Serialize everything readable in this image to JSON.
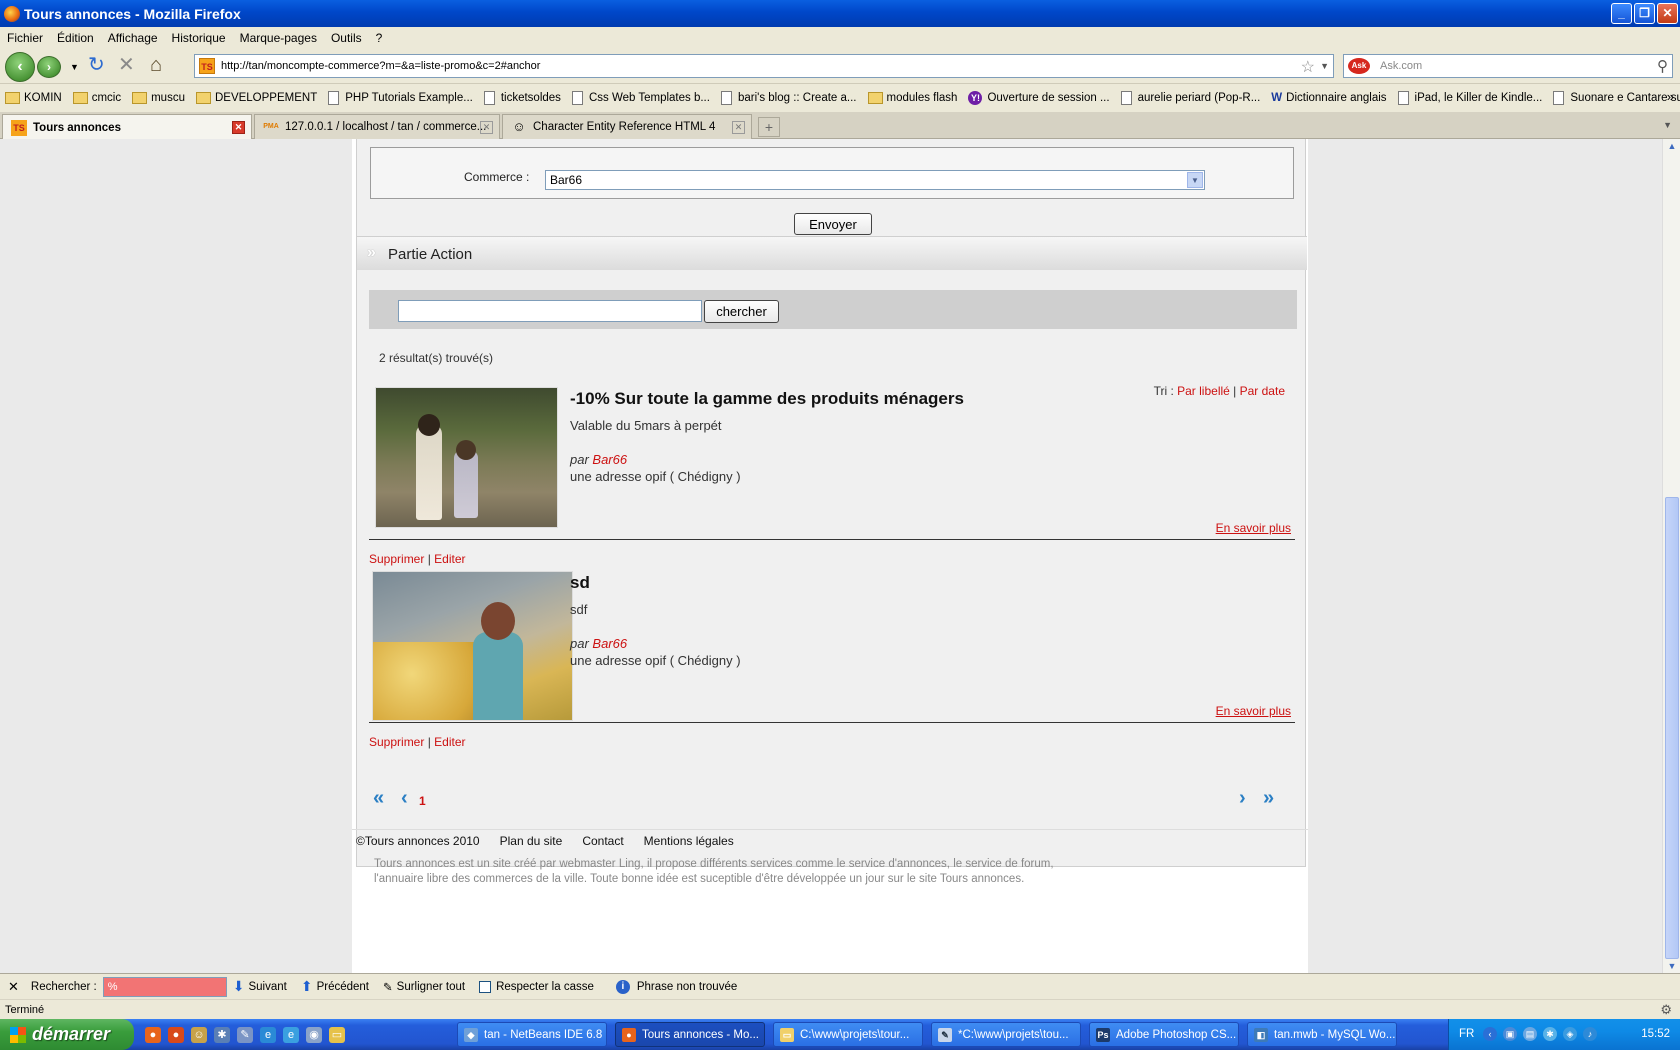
{
  "window": {
    "title": "Tours annonces - Mozilla Firefox",
    "min": "_",
    "max": "❐",
    "close": "✕"
  },
  "menu": [
    "Fichier",
    "Édition",
    "Affichage",
    "Historique",
    "Marque-pages",
    "Outils",
    "?"
  ],
  "nav": {
    "url": "http://tan/moncompte-commerce?m=&a=liste-promo&c=2#anchor",
    "site_icon": "TS",
    "search_placeholder": "Ask.com",
    "search_engine": "Ask"
  },
  "bookmarks": [
    {
      "label": "KOMIN",
      "icon": "folder"
    },
    {
      "label": "cmcic",
      "icon": "folder"
    },
    {
      "label": "muscu",
      "icon": "folder"
    },
    {
      "label": "DEVELOPPEMENT",
      "icon": "folder"
    },
    {
      "label": "PHP Tutorials Example...",
      "icon": "page"
    },
    {
      "label": "ticketsoldes",
      "icon": "page"
    },
    {
      "label": "Css Web Templates b...",
      "icon": "page"
    },
    {
      "label": "bari's blog :: Create a...",
      "icon": "page"
    },
    {
      "label": "modules flash",
      "icon": "folder"
    },
    {
      "label": "Ouverture de session ...",
      "icon": "yahoo"
    },
    {
      "label": "aurelie periard (Pop-R...",
      "icon": "page"
    },
    {
      "label": "Dictionnaire anglais",
      "icon": "wr"
    },
    {
      "label": "iPad, le Killer de Kindle...",
      "icon": "page"
    },
    {
      "label": "Suonare e Cantare su...",
      "icon": "page"
    }
  ],
  "bookmarks_more": "»",
  "tabs": [
    {
      "label": "Tours annonces",
      "icon": "TS"
    },
    {
      "label": "127.0.0.1 / localhost / tan / commerce...",
      "icon": "PMA"
    },
    {
      "label": "Character Entity Reference HTML 4",
      "icon": "☺"
    }
  ],
  "page": {
    "commerce_label": "Commerce :",
    "commerce_value": "Bar66",
    "submit_label": "Envoyer",
    "section_title": "Partie Action",
    "search_value": "",
    "search_button": "chercher",
    "results_count": "2 résultat(s) trouvé(s)",
    "sort_prefix": "Tri : ",
    "sort_by_label": "Par libellé",
    "sort_sep": " | ",
    "sort_by_date": "Par date",
    "promos": [
      {
        "title": "-10% Sur toute la gamme des produits ménagers",
        "desc": "Valable du 5mars à perpét",
        "by_prefix": "par ",
        "by": "Bar66",
        "address": "une adresse opif ( Chédigny )",
        "more": "En savoir plus",
        "delete": "Supprimer",
        "sep": " | ",
        "edit": "Editer"
      },
      {
        "title": "sd",
        "desc": "sdf",
        "by_prefix": "par ",
        "by": "Bar66",
        "address": "une adresse opif ( Chédigny )",
        "more": "En savoir plus",
        "delete": "Supprimer",
        "sep": " | ",
        "edit": "Editer"
      }
    ],
    "pager": {
      "first": "«",
      "prev": "‹",
      "current": "1",
      "next": "›",
      "last": "»"
    },
    "footer": {
      "copyright": "©Tours annonces 2010",
      "links": [
        "Plan du site",
        "Contact",
        "Mentions légales"
      ],
      "text1": "Tours annonces est un site créé par webmaster Ling, il propose différents services comme le service d'annonces, le service de forum,",
      "text2": "l'annuaire libre des commerces de la ville. Toute bonne idée est suceptible d'être développée un jour sur le site Tours annonces."
    }
  },
  "findbar": {
    "close": "✕",
    "label": "Rechercher :",
    "value": "%",
    "next": "Suivant",
    "prev": "Précédent",
    "highlight": "Surligner tout",
    "match_case": "Respecter la casse",
    "status": "Phrase non trouvée"
  },
  "status": {
    "text": "Terminé"
  },
  "taskbar": {
    "start": "démarrer",
    "tasks": [
      "tan - NetBeans IDE 6.8",
      "Tours annonces - Mo...",
      "C:\\www\\projets\\tour...",
      "*C:\\www\\projets\\tou...",
      "Adobe Photoshop CS...",
      "tan.mwb - MySQL Wo..."
    ],
    "lang": "FR",
    "clock": "15:52"
  },
  "colors": {
    "link_red": "#cc1111",
    "titlebar_blue": "#0047c9",
    "taskbar_blue": "#245edb",
    "start_green": "#3a9d3c"
  }
}
